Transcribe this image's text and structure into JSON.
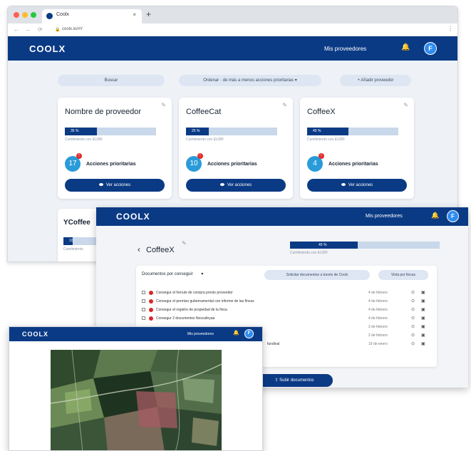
{
  "browser": {
    "tab_title": "Coolx",
    "tab_close": "×",
    "new_tab": "+",
    "url": "coolx.io/#!/",
    "lock": "🔒",
    "back": "←",
    "forward": "→",
    "reload": "⟳",
    "menu": "⋮"
  },
  "app": {
    "logo": "COOLX",
    "nav_link": "Mis proveedores",
    "bell": "🔔",
    "avatar": "F",
    "accent_color": "#0b3a85"
  },
  "controls": {
    "search": "Buscar",
    "sort": "Ordenar · de más a menos acciones prioritarias",
    "sort_caret": "▾",
    "add_supplier": "+ Añadir proveedor"
  },
  "cards": [
    {
      "name": "Nombre de proveedor",
      "progress_label": "35 %",
      "progress": 0.35,
      "caption": "Cumlimiento con EUDR",
      "count": "17",
      "priority_label": "Acciones prioritarias",
      "button": "Ver acciones"
    },
    {
      "name": "CoffeeCat",
      "progress_label": "25 %",
      "progress": 0.25,
      "caption": "Cumlimiento con EUDR",
      "count": "10",
      "priority_label": "Acciones prioritarias",
      "button": "Ver acciones"
    },
    {
      "name": "CoffeeX",
      "progress_label": "45 %",
      "progress": 0.45,
      "caption": "Cumlimiento con EUDR",
      "count": "4",
      "priority_label": "Acciones prioritarias",
      "button": "Ver acciones"
    }
  ],
  "partial_card": {
    "name": "YCoffee",
    "progress_label": "10",
    "caption": "Cumlimiento"
  },
  "detail": {
    "logo": "COOLX",
    "nav_link": "Mis proveedores",
    "avatar": "F",
    "back": "‹",
    "title": "CoffeeX",
    "progress_label": "45 %",
    "progress": 0.45,
    "caption": "Cumlimiento con EUDR",
    "filter": "Documentos por conseguir",
    "filter_caret": "▾",
    "request_button": "Solicitar documentos a través de Coolx",
    "view_button": "Vista por fincas",
    "upload_button": "Subir documentos",
    "rows": [
      {
        "label": "Consegur el fornulo de compra proxto proveedor",
        "date": "4 de febrero"
      },
      {
        "label": "Consegur el permiso gubernamental con informe de las fincas",
        "date": "4 de febrero"
      },
      {
        "label": "Consegur el registro de propiedad de la finca",
        "date": "4 de febrero"
      },
      {
        "label": "Consegur 2 documentos Nescafeyaa",
        "date": "4 de febrero"
      },
      {
        "label": "",
        "date": "2 de febrero"
      },
      {
        "label": "",
        "date": "2 de febrero"
      },
      {
        "label": "fundival",
        "date": "19 de enero"
      }
    ],
    "row_icons": {
      "eye": "⊙",
      "doc": "▣"
    }
  },
  "map_window": {
    "logo": "COOLX",
    "nav_link": "Mis proveedores",
    "avatar": "F"
  }
}
